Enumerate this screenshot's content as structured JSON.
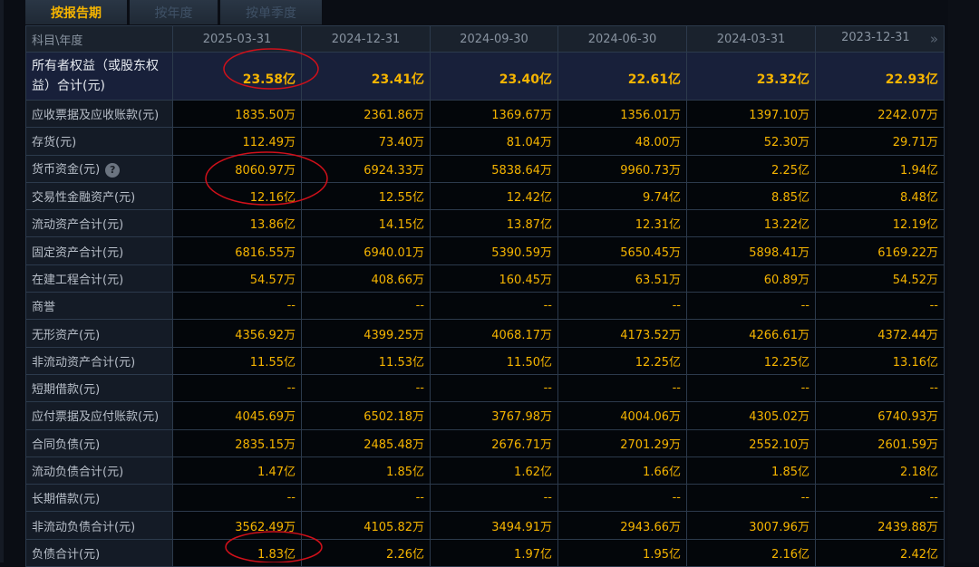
{
  "tabs": [
    "按报告期",
    "按年度",
    "按单季度"
  ],
  "header": {
    "label": "科目\\年度",
    "periods": [
      "2025-03-31",
      "2024-12-31",
      "2024-09-30",
      "2024-06-30",
      "2024-03-31",
      "2023-12-31"
    ],
    "more_icon": "»"
  },
  "help_icon": "?",
  "rows": [
    {
      "label": "所有者权益（或股东权益）合计(元)",
      "values": [
        "23.58亿",
        "23.41亿",
        "23.40亿",
        "22.61亿",
        "23.32亿",
        "22.93亿"
      ]
    },
    {
      "label": "应收票据及应收账款(元)",
      "values": [
        "1835.50万",
        "2361.86万",
        "1369.67万",
        "1356.01万",
        "1397.10万",
        "2242.07万"
      ]
    },
    {
      "label": "存货(元)",
      "values": [
        "112.49万",
        "73.40万",
        "81.04万",
        "48.00万",
        "52.30万",
        "29.71万"
      ]
    },
    {
      "label": "货币资金(元)",
      "values": [
        "8060.97万",
        "6924.33万",
        "5838.64万",
        "9960.73万",
        "2.25亿",
        "1.94亿"
      ]
    },
    {
      "label": "交易性金融资产(元)",
      "values": [
        "12.16亿",
        "12.55亿",
        "12.42亿",
        "9.74亿",
        "8.85亿",
        "8.48亿"
      ]
    },
    {
      "label": "流动资产合计(元)",
      "values": [
        "13.86亿",
        "14.15亿",
        "13.87亿",
        "12.31亿",
        "13.22亿",
        "12.19亿"
      ]
    },
    {
      "label": "固定资产合计(元)",
      "values": [
        "6816.55万",
        "6940.01万",
        "5390.59万",
        "5650.45万",
        "5898.41万",
        "6169.22万"
      ]
    },
    {
      "label": "在建工程合计(元)",
      "values": [
        "54.57万",
        "408.66万",
        "160.45万",
        "63.51万",
        "60.89万",
        "54.52万"
      ]
    },
    {
      "label": "商誉",
      "values": [
        "--",
        "--",
        "--",
        "--",
        "--",
        "--"
      ]
    },
    {
      "label": "无形资产(元)",
      "values": [
        "4356.92万",
        "4399.25万",
        "4068.17万",
        "4173.52万",
        "4266.61万",
        "4372.44万"
      ]
    },
    {
      "label": "非流动资产合计(元)",
      "values": [
        "11.55亿",
        "11.53亿",
        "11.50亿",
        "12.25亿",
        "12.25亿",
        "13.16亿"
      ]
    },
    {
      "label": "短期借款(元)",
      "values": [
        "--",
        "--",
        "--",
        "--",
        "--",
        "--"
      ]
    },
    {
      "label": "应付票据及应付账款(元)",
      "values": [
        "4045.69万",
        "6502.18万",
        "3767.98万",
        "4004.06万",
        "4305.02万",
        "6740.93万"
      ]
    },
    {
      "label": "合同负债(元)",
      "values": [
        "2835.15万",
        "2485.48万",
        "2676.71万",
        "2701.29万",
        "2552.10万",
        "2601.59万"
      ]
    },
    {
      "label": "流动负债合计(元)",
      "values": [
        "1.47亿",
        "1.85亿",
        "1.62亿",
        "1.66亿",
        "1.85亿",
        "2.18亿"
      ]
    },
    {
      "label": "长期借款(元)",
      "values": [
        "--",
        "--",
        "--",
        "--",
        "--",
        "--"
      ]
    },
    {
      "label": "非流动负债合计(元)",
      "values": [
        "3562.49万",
        "4105.82万",
        "3494.91万",
        "2943.66万",
        "3007.96万",
        "2439.88万"
      ]
    },
    {
      "label": "负债合计(元)",
      "values": [
        "1.83亿",
        "2.26亿",
        "1.97亿",
        "1.95亿",
        "2.16亿",
        "2.42亿"
      ]
    }
  ]
}
